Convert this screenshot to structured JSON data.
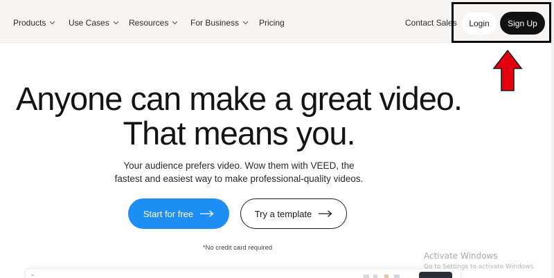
{
  "nav": {
    "items": [
      {
        "label": "Products",
        "dropdown": true
      },
      {
        "label": "Use Cases",
        "dropdown": true
      },
      {
        "label": "Resources",
        "dropdown": true
      },
      {
        "label": "For Business",
        "dropdown": true
      },
      {
        "label": "Pricing",
        "dropdown": false
      }
    ],
    "contact_sales": "Contact Sales",
    "login": "Login",
    "signup": "Sign Up"
  },
  "hero": {
    "title_line1": "Anyone can make a great video.",
    "title_line2": "That means you.",
    "subtitle_line1": "Your audience prefers video. Wow them with VEED, the",
    "subtitle_line2": "fastest and easiest way to make professional-quality videos.",
    "primary_cta": "Start for free",
    "secondary_cta": "Try a template",
    "note": "*No credit card required"
  },
  "watermark": {
    "line1": "Activate Windows",
    "line2": "Go to Settings to activate Windows."
  },
  "icons": {
    "dropdown": "chevron-down-icon",
    "cta_arrow": "arrow-right-icon",
    "annotation": "red-up-arrow-icon"
  },
  "colors": {
    "primary_blue": "#1e8ef5",
    "signup_black": "#111111",
    "annotation_red": "#e3000f",
    "nav_bg": "#f6f5f3"
  }
}
